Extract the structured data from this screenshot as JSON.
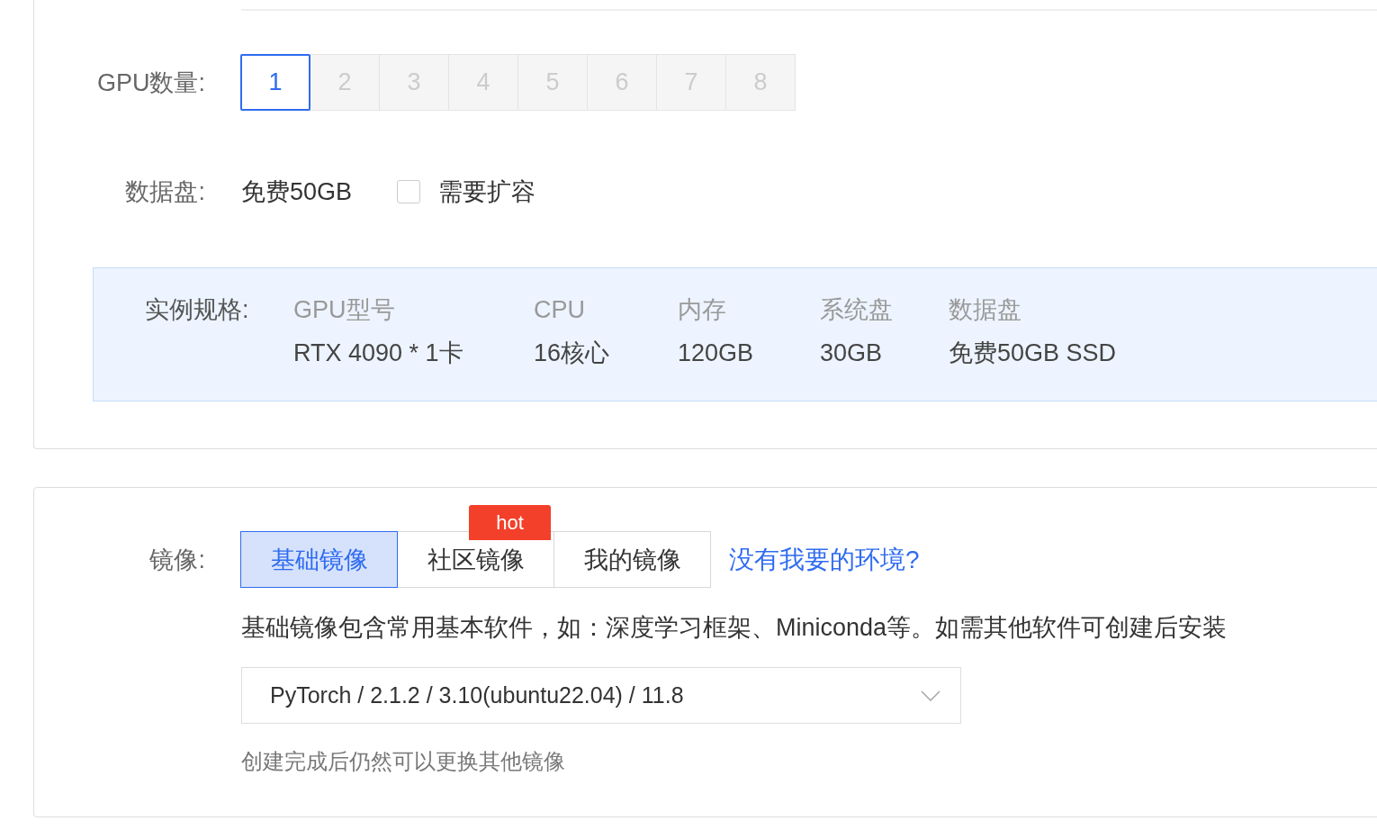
{
  "gpu_count": {
    "label": "GPU数量:",
    "options": [
      {
        "label": "1",
        "selected": true,
        "disabled": false
      },
      {
        "label": "2",
        "selected": false,
        "disabled": true
      },
      {
        "label": "3",
        "selected": false,
        "disabled": true
      },
      {
        "label": "4",
        "selected": false,
        "disabled": true
      },
      {
        "label": "5",
        "selected": false,
        "disabled": true
      },
      {
        "label": "6",
        "selected": false,
        "disabled": true
      },
      {
        "label": "7",
        "selected": false,
        "disabled": true
      },
      {
        "label": "8",
        "selected": false,
        "disabled": true
      }
    ]
  },
  "data_disk": {
    "label": "数据盘:",
    "value": "免费50GB",
    "expand_checkbox": {
      "label": "需要扩容",
      "checked": false
    }
  },
  "spec": {
    "label": "实例规格:",
    "columns": [
      {
        "header": "GPU型号",
        "value": "RTX 4090 * 1卡"
      },
      {
        "header": "CPU",
        "value": "16核心"
      },
      {
        "header": "内存",
        "value": "120GB"
      },
      {
        "header": "系统盘",
        "value": "30GB"
      },
      {
        "header": "数据盘",
        "value": "免费50GB SSD"
      }
    ]
  },
  "image": {
    "label": "镜像:",
    "tabs": [
      {
        "label": "基础镜像",
        "selected": true
      },
      {
        "label": "社区镜像",
        "selected": false,
        "badge": "hot"
      },
      {
        "label": "我的镜像",
        "selected": false
      }
    ],
    "help_link": "没有我要的环境?",
    "description": "基础镜像包含常用基本软件，如：深度学习框架、Miniconda等。如需其他软件可创建后安装",
    "select_value": "PyTorch / 2.1.2 / 3.10(ubuntu22.04) / 11.8",
    "hint": "创建完成后仍然可以更换其他镜像"
  }
}
